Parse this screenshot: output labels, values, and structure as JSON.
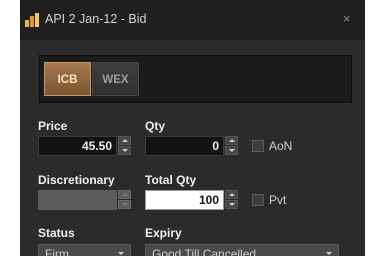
{
  "window": {
    "title": "API 2 Jan-12 - Bid",
    "close_glyph": "×",
    "icon": "app-logo-icon",
    "accent": "#f2b43a"
  },
  "venues": {
    "items": [
      {
        "label": "ICB",
        "selected": true
      },
      {
        "label": "WEX",
        "selected": false
      }
    ],
    "selected_color": "#8f6a3f"
  },
  "price": {
    "label": "Price",
    "value": "45.50"
  },
  "qty": {
    "label": "Qty",
    "value": "0"
  },
  "aon": {
    "label": "AoN",
    "checked": false
  },
  "discretionary": {
    "label": "Discretionary",
    "value": "",
    "enabled": false
  },
  "total_qty": {
    "label": "Total Qty",
    "value": "100"
  },
  "pvt": {
    "label": "Pvt",
    "checked": false
  },
  "status": {
    "label": "Status",
    "value": "Firm"
  },
  "expiry": {
    "label": "Expiry",
    "value": "Good Till Cancelled"
  }
}
